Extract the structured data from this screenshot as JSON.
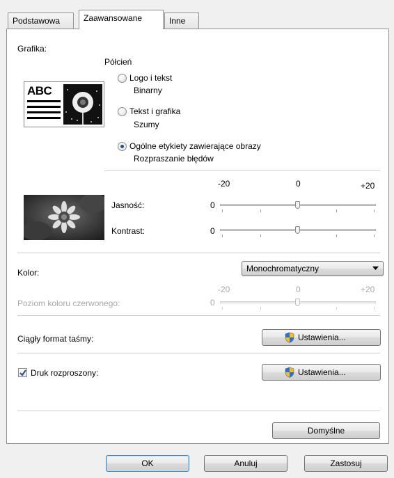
{
  "tabs": [
    {
      "label": "Podstawowa",
      "active": false
    },
    {
      "label": "Zaawansowane",
      "active": true
    },
    {
      "label": "Inne",
      "active": false
    }
  ],
  "graphics": {
    "label": "Grafika:",
    "halftone_label": "Półcień",
    "preview_text": "ABC",
    "options": [
      {
        "title": "Logo i tekst",
        "subtitle": "Binarny",
        "selected": false
      },
      {
        "title": "Tekst i grafika",
        "subtitle": "Szumy",
        "selected": false
      },
      {
        "title": "Ogólne etykiety zawierające obrazy",
        "subtitle": "Rozpraszanie błędów",
        "selected": true
      }
    ]
  },
  "adjust": {
    "scale_min": "-20",
    "scale_mid": "0",
    "scale_max": "+20",
    "brightness_label": "Jasność:",
    "brightness_value": "0",
    "contrast_label": "Kontrast:",
    "contrast_value": "0"
  },
  "color": {
    "label": "Kolor:",
    "selected": "Monochromatyczny",
    "red_scale_min": "-20",
    "red_scale_mid": "0",
    "red_scale_max": "+20",
    "red_label": "Poziom koloru czerwonego:",
    "red_value": "0"
  },
  "continuous": {
    "label": "Ciągły format taśmy:",
    "button": "Ustawienia..."
  },
  "distributed": {
    "label": "Druk rozproszony:",
    "checked": true,
    "button": "Ustawienia..."
  },
  "defaults_button": "Domyślne",
  "footer": {
    "ok": "OK",
    "cancel": "Anuluj",
    "apply": "Zastosuj"
  }
}
